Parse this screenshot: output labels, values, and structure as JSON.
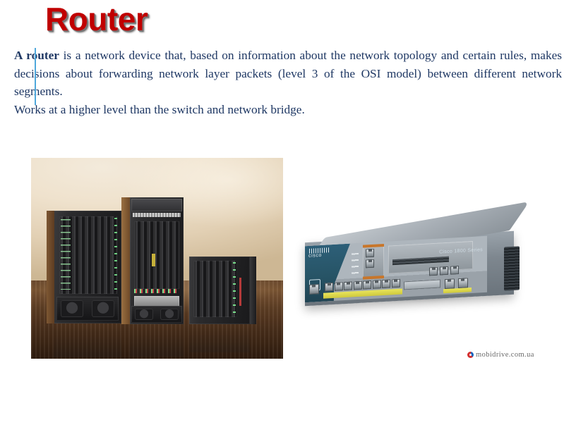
{
  "slide": {
    "title": "Router",
    "title_color": "#C00000",
    "background": "#FFFFFF",
    "text_color": "#1F3864"
  },
  "body": {
    "paragraph_1_lead": "A router",
    "paragraph_1_rest": " is a network device that, based on information about the network topology and certain rules, makes decisions about forwarding network layer packets (level 3 of the OSI model) between different network segments.",
    "paragraph_2": "Works at a higher level than the switch and network bridge."
  },
  "caret": {
    "color": "#4FA8DC"
  },
  "images": {
    "photo_chassis": {
      "alt": "Three black Cisco modular chassis routers standing on a glossy wooden table with a beige wall background",
      "device_count": 3
    },
    "photo_1800": {
      "alt": "Cisco desktop integrated services router, front three-quarter view",
      "brand": "cisco",
      "model_label": "Cisco 1800 Series"
    }
  },
  "watermark": {
    "text": "mobidrive.com.ua",
    "logo": "swirl-icon"
  }
}
